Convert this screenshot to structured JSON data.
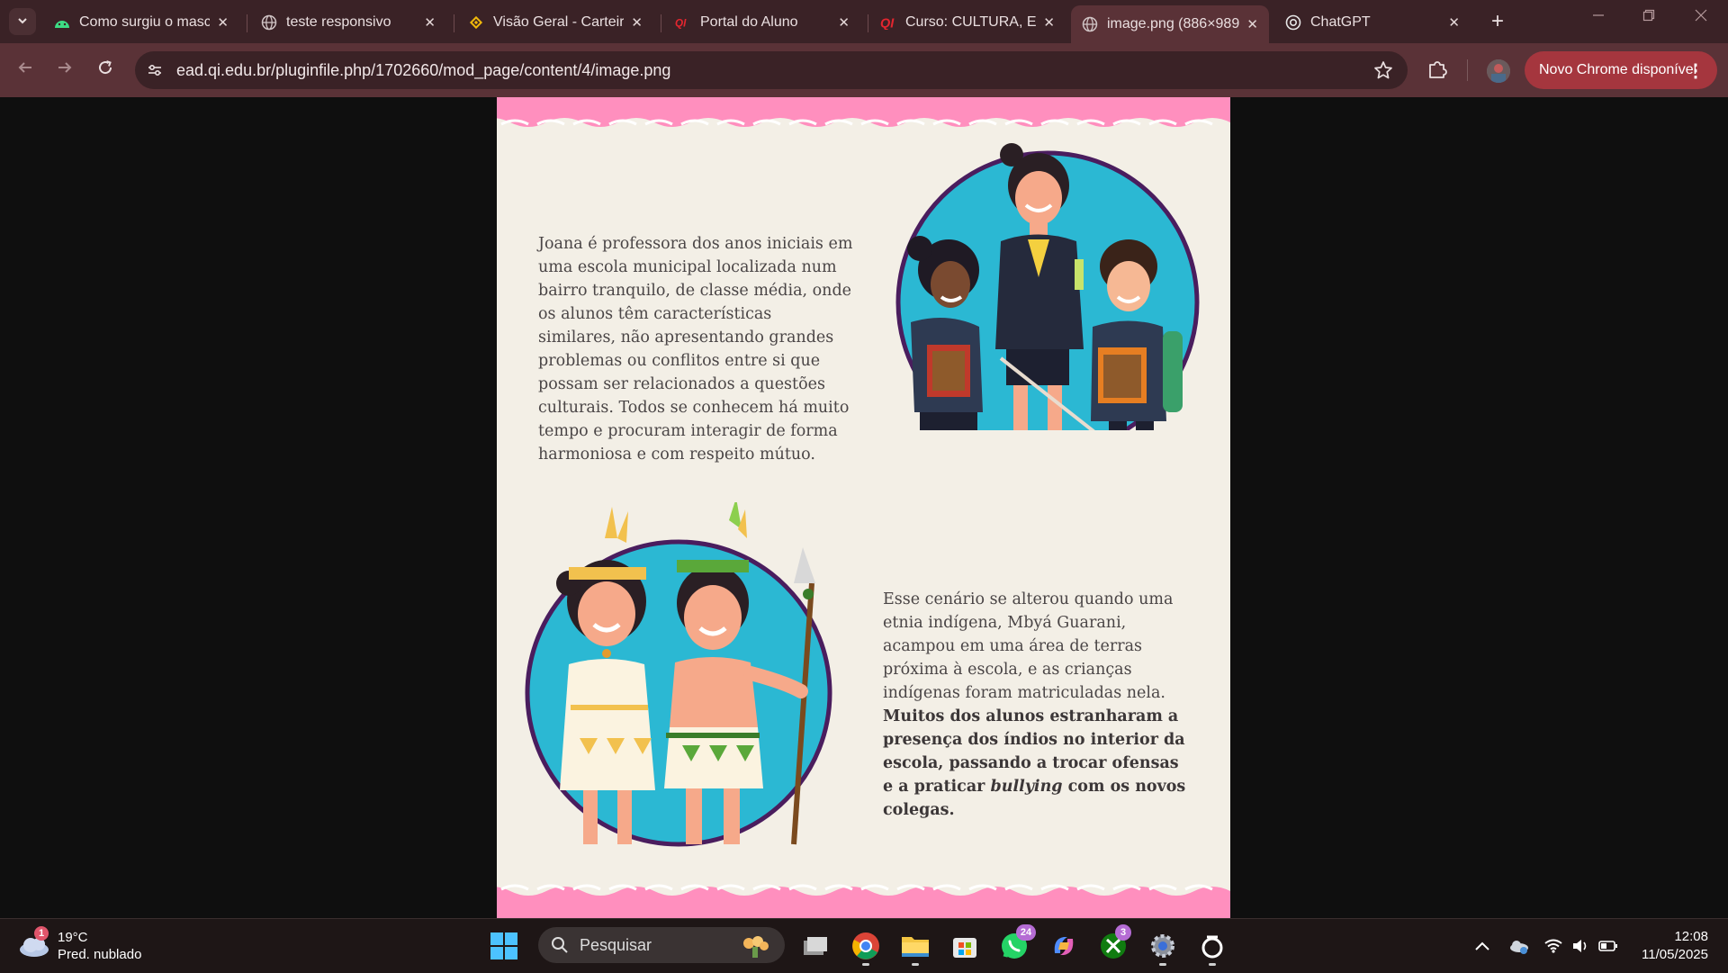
{
  "browser": {
    "tabs": [
      {
        "title": "Como surgiu o masco",
        "favicon": "android-icon",
        "active": false
      },
      {
        "title": "teste responsivo",
        "favicon": "globe-icon",
        "active": false
      },
      {
        "title": "Visão Geral - Carteira",
        "favicon": "binance-icon",
        "active": false
      },
      {
        "title": "Portal do Aluno",
        "favicon": "qi-icon",
        "active": false
      },
      {
        "title": "Curso: CULTURA, ETN",
        "favicon": "qi-icon",
        "active": false
      },
      {
        "title": "image.png (886×989",
        "favicon": "globe-icon",
        "active": true
      },
      {
        "title": "ChatGPT",
        "favicon": "chatgpt-icon",
        "active": false
      }
    ],
    "close_glyph": "✕",
    "new_tab_glyph": "+",
    "url": "ead.qi.edu.br/pluginfile.php/1702660/mod_page/content/4/image.png",
    "update_button": "Novo Chrome disponível"
  },
  "content": {
    "paragraph1": "Joana é professora dos anos iniciais em uma escola municipal localizada num bairro tranquilo, de classe média, onde os alunos têm características similares, não apresentando grandes problemas ou conflitos entre si que possam ser relacionados a questões culturais. Todos se conhecem há muito tempo e procuram interagir de forma harmoniosa e com respeito mútuo.",
    "paragraph2_plain": "Esse cenário se alterou quando uma etnia indígena, Mbyá Guarani, acampou em uma área de terras próxima à escola, e as crianças indígenas foram matriculadas nela. ",
    "paragraph2_bold": "Muitos dos alunos estranharam a presença dos índios no interior da escola, passando a trocar ofensas e a praticar ",
    "paragraph2_italic": "bullying",
    "paragraph2_end": " com os novos colegas."
  },
  "taskbar": {
    "weather_badge": "1",
    "temperature": "19°C",
    "condition": "Pred. nublado",
    "search_placeholder": "Pesquisar",
    "whatsapp_badge": "24",
    "xbox_badge": "3",
    "time": "12:08",
    "date": "11/05/2025"
  },
  "colors": {
    "tabstrip": "#3a2226",
    "toolbar": "#5a3237",
    "page_bg": "#f3efe6",
    "pink_border": "#ff8fbe",
    "circle_teal": "#2bb8d3",
    "circle_ring": "#4a1d5e"
  }
}
